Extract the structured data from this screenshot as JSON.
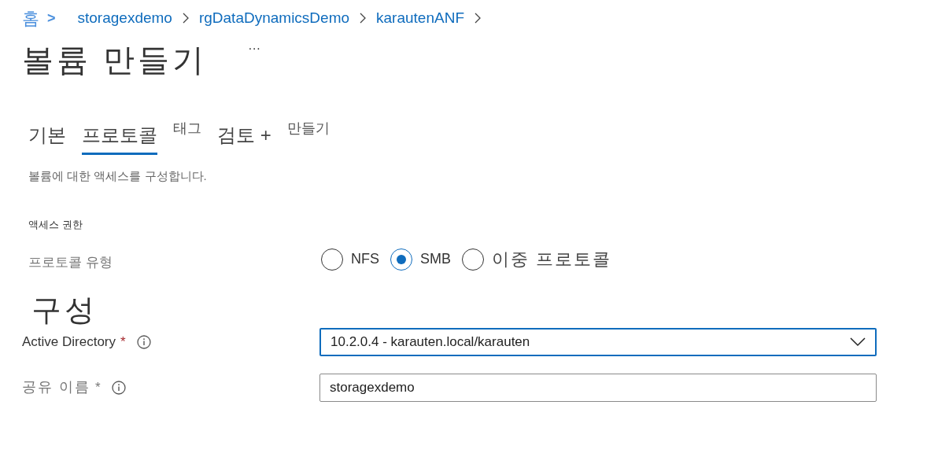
{
  "breadcrumb": {
    "home": "홈",
    "separator": ">",
    "items": [
      "storagexdemo",
      "rgDataDynamicsDemo",
      "karautenANF"
    ]
  },
  "page": {
    "title": "볼륨 만들기",
    "more": "···"
  },
  "tabs": [
    {
      "label": "기본",
      "selected": false,
      "kind": "large"
    },
    {
      "label": "프로토콜",
      "selected": true,
      "kind": "large"
    },
    {
      "label": "태그",
      "selected": false,
      "kind": "small"
    },
    {
      "label": "검토 +",
      "selected": false,
      "kind": "large"
    },
    {
      "label": "만들기",
      "selected": false,
      "kind": "small"
    }
  ],
  "description": "볼륨에 대한 액세스를 구성합니다.",
  "access": {
    "heading": "액세스 권한",
    "label": "프로토콜 유형",
    "options": [
      {
        "label": "NFS",
        "selected": false,
        "kind": "latin"
      },
      {
        "label": "SMB",
        "selected": true,
        "kind": "latin"
      },
      {
        "label": "이중 프로토콜",
        "selected": false,
        "kind": "hangul"
      }
    ]
  },
  "configuration": {
    "heading": "구성",
    "fields": [
      {
        "kind": "dropdown",
        "label": "Active Directory",
        "required": "*",
        "value": "10.2.0.4 - karauten.local/karauten",
        "focused": true
      },
      {
        "kind": "text",
        "label": "공유 이름",
        "required": "*",
        "value": "storagexdemo",
        "focused": false
      }
    ]
  }
}
